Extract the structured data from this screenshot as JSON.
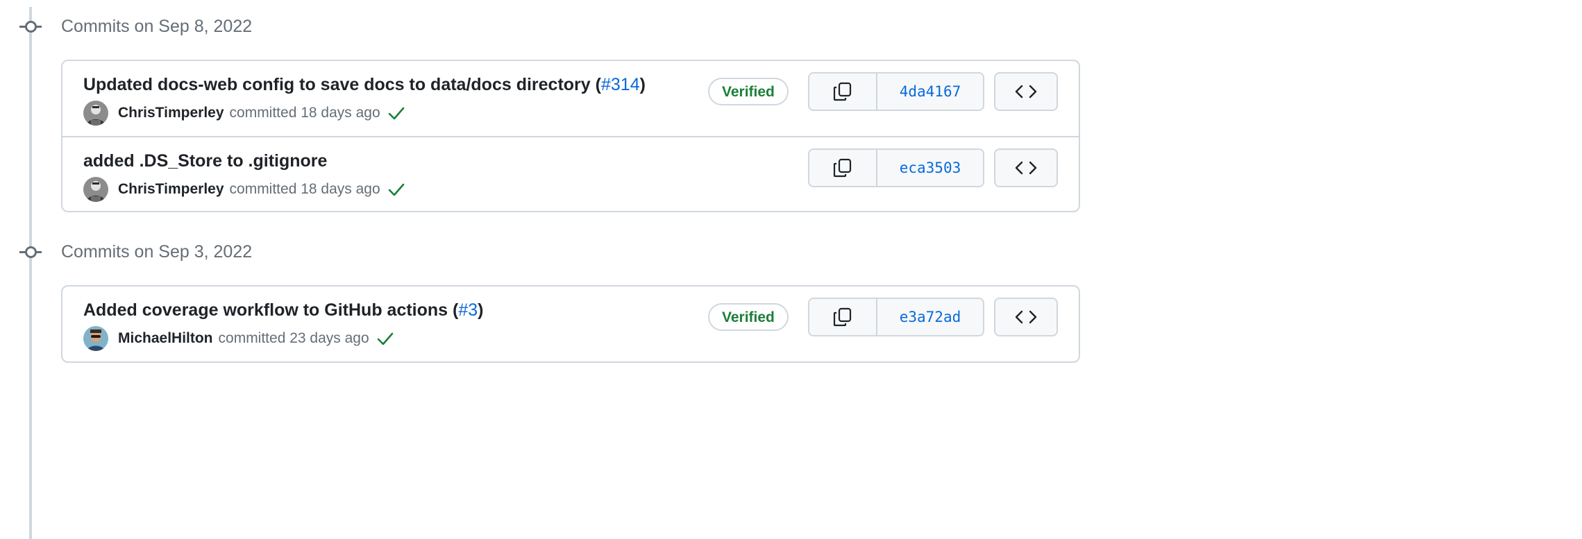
{
  "colors": {
    "accent": "#0969da",
    "verified": "#1a7f37",
    "muted": "#656d76",
    "border": "#d0d7de"
  },
  "groups": [
    {
      "title": "Commits on Sep 8, 2022",
      "commits": [
        {
          "title": "Updated docs-web config to save docs to data/docs directory",
          "pr_open": "(",
          "pr": "#314",
          "pr_close": ")",
          "author": "ChrisTimperley",
          "action": "committed",
          "time": "18 days ago",
          "verified": "Verified",
          "sha": "4da4167",
          "status_icon": "check-icon"
        },
        {
          "title": "added .DS_Store to .gitignore",
          "author": "ChrisTimperley",
          "action": "committed",
          "time": "18 days ago",
          "sha": "eca3503",
          "status_icon": "check-icon"
        }
      ]
    },
    {
      "title": "Commits on Sep 3, 2022",
      "commits": [
        {
          "title": "Added coverage workflow to GitHub actions",
          "pr_open": "(",
          "pr": "#3",
          "pr_close": ")",
          "author": "MichaelHilton",
          "action": "committed",
          "time": "23 days ago",
          "verified": "Verified",
          "sha": "e3a72ad",
          "status_icon": "check-icon"
        }
      ]
    }
  ],
  "icons": {
    "copy": "copy-icon",
    "browse": "code-icon",
    "status": "check-icon",
    "timeline": "commit-node-icon"
  }
}
